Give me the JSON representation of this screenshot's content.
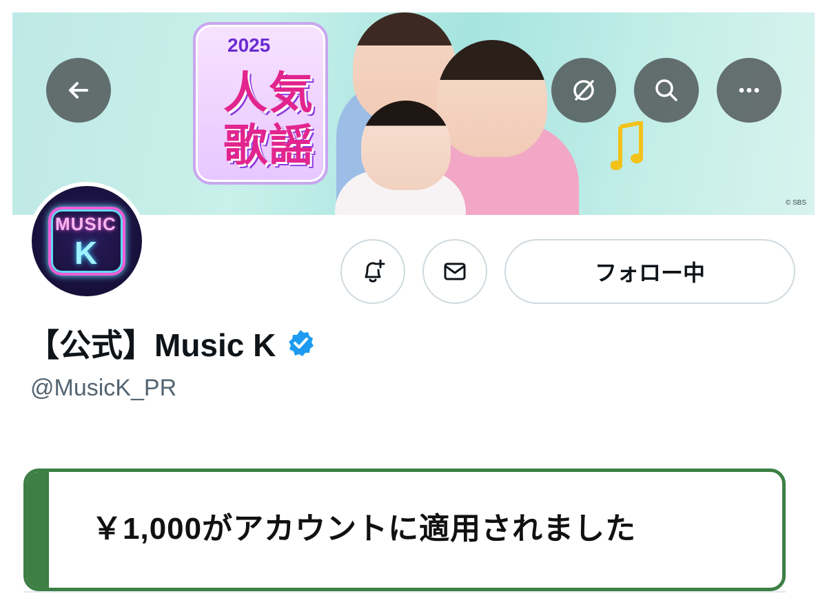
{
  "banner": {
    "logo_year": "2025",
    "logo_line1": "人気",
    "logo_line2": "歌謡",
    "copyright": "© SBS"
  },
  "nav": {
    "back_icon": "arrow-left-icon",
    "translate_icon": "no-translate-icon",
    "search_icon": "search-icon",
    "more_icon": "more-horizontal-icon"
  },
  "avatar": {
    "line1": "MUSIC",
    "line2": "K"
  },
  "actions": {
    "notify_icon": "bell-plus-icon",
    "message_icon": "envelope-icon",
    "follow_label": "フォロー中"
  },
  "profile": {
    "display_name": "【公式】Music K",
    "handle": "@MusicK_PR",
    "verified_color": "#1d9bf0"
  },
  "toast": {
    "message": "￥1,000がアカウントに適用されました",
    "accent_color": "#3d7f45"
  }
}
